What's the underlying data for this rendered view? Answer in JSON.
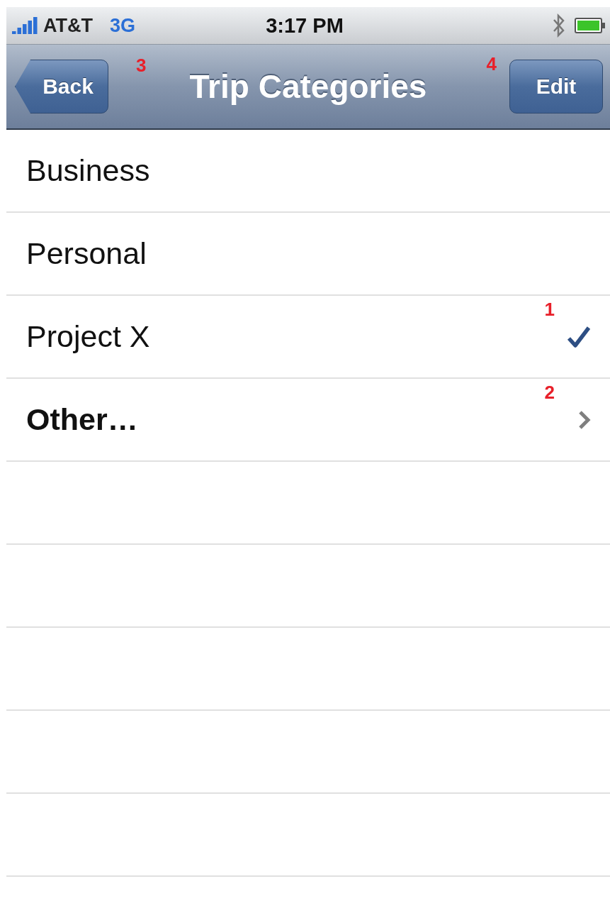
{
  "status_bar": {
    "carrier": "AT&T",
    "network": "3G",
    "time": "3:17 PM"
  },
  "nav_bar": {
    "back": "Back",
    "title": "Trip Categories",
    "title_callout": "3",
    "edit": "Edit",
    "edit_callout": "4"
  },
  "rows": [
    {
      "label": "Business",
      "kind": "option",
      "selected": false
    },
    {
      "label": "Personal",
      "kind": "option",
      "selected": false
    },
    {
      "label": "Project X",
      "kind": "option",
      "selected": true,
      "callout": "1"
    },
    {
      "label": "Other…",
      "kind": "more",
      "selected": false,
      "callout": "2"
    }
  ]
}
